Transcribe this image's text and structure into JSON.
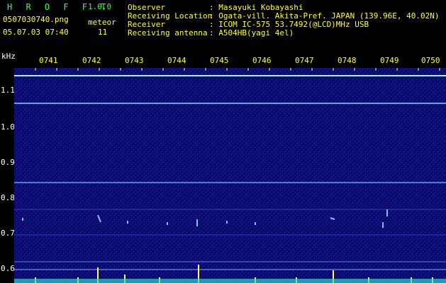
{
  "app": {
    "name": "H R O F F T",
    "version": "1.0.0"
  },
  "file": {
    "name": "0507030740.png",
    "datetime": "05.07.03 07:40"
  },
  "meteor": {
    "label": "meteor",
    "count": "11"
  },
  "info": {
    "observer_label": "Observer",
    "observer_value": ": Masayuki Kobayashi",
    "location_label": "Receiving Location",
    "location_value": ": Ogata-vill. Akita-Pref. JAPAN (139.96E, 40.02N)",
    "receiver_label": "Receiver",
    "receiver_value": ": ICOM IC-575 53.7492(@LCD)MHz USB",
    "antenna_label": "Receiving antenna",
    "antenna_value": ": A504HB(yagi 4el)"
  },
  "axis": {
    "y_unit": "kHz",
    "x_ticks": [
      "0741",
      "0742",
      "0743",
      "0744",
      "0745",
      "0746",
      "0747",
      "0748",
      "0749",
      "0750"
    ],
    "y_ticks": [
      "1.1",
      "1.0",
      "0.9",
      "0.8",
      "0.7",
      "0.6"
    ]
  },
  "colors": {
    "background": "#000000",
    "spectrogram": "#0a0a70",
    "header_green": "#3cff3c",
    "header_yellow": "#ffff33",
    "carrier_line": "#a8f0ff"
  }
}
